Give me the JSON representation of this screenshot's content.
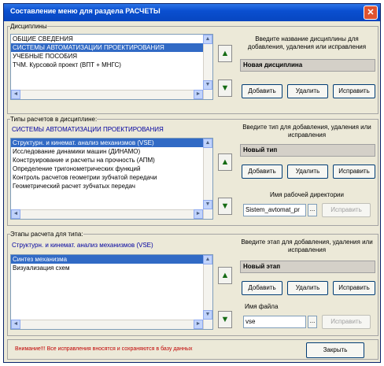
{
  "window": {
    "title": "Составление меню для раздела РАСЧЕТЫ",
    "close_glyph": "✕"
  },
  "disciplines": {
    "label": "Дисциплины",
    "items": [
      "ОБЩИЕ СВЕДЕНИЯ",
      "СИСТЕМЫ АВТОМАТИЗАЦИИ ПРОЕКТИРОВАНИЯ",
      "УЧЕБНЫЕ ПОСОБИЯ",
      "ТЧМ. Курсовой проект (ВПТ + МНГС)"
    ],
    "selected_index": 1,
    "hint": "Введите название дисциплины для добавления, удаления или исправления",
    "field_value": "Новая дисциплина",
    "add": "Добавить",
    "delete": "Удалить",
    "edit": "Исправить"
  },
  "calc_types": {
    "label": "Типы расчетов в дисциплине:",
    "current_discipline": "СИСТЕМЫ АВТОМАТИЗАЦИИ ПРОЕКТИРОВАНИЯ",
    "items": [
      "Структурн. и кинемат. анализ механизмов (VSE)",
      "Исследование динамики машин (ДИНАМО)",
      "Конструирование и расчеты на прочность (АПМ)",
      "Определение тригонометрических функций",
      "Контроль расчетов геометрии зубчатой передачи",
      "Геометрический расчет зубчатых передач"
    ],
    "selected_index": 0,
    "hint": "Введите тип для добавления, удаления или исправления",
    "field_value": "Новый тип",
    "add": "Добавить",
    "delete": "Удалить",
    "edit": "Исправить",
    "workdir_label": "Имя рабочей директории",
    "workdir_value": "Sistem_avtomat_pr",
    "workdir_browse": "...",
    "workdir_edit": "Исправить"
  },
  "stages": {
    "label": "Этапы расчета для типа:",
    "current_type": "Структурн. и кинемат. анализ механизмов (VSE)",
    "items": [
      "Синтез механизма",
      "Визуализация схем"
    ],
    "selected_index": 0,
    "hint": "Введите этап для добавления, удаления или исправления",
    "field_value": "Новый этап",
    "add": "Добавить",
    "delete": "Удалить",
    "edit": "Исправить",
    "file_label": "Имя файла",
    "file_value": "vse",
    "file_browse": "...",
    "file_edit": "Исправить"
  },
  "footer": {
    "warning": "Внимание!!! Все исправления вносятся и сохраняются в базу данных",
    "close": "Закрыть"
  },
  "arrows": {
    "up": "▲",
    "down": "▼",
    "left": "◄",
    "right": "►"
  }
}
